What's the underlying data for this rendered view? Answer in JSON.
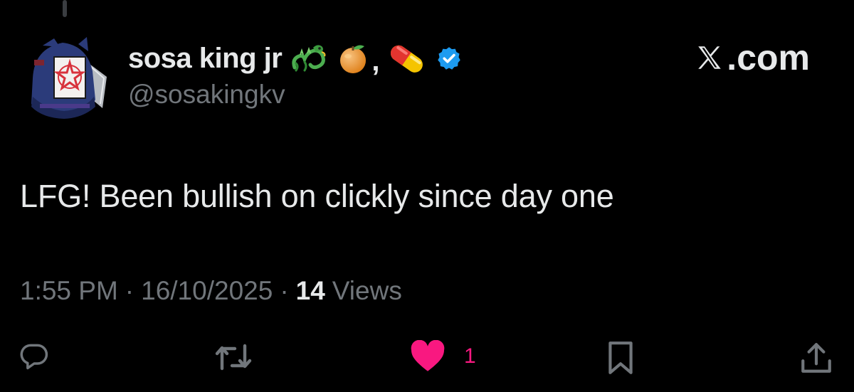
{
  "tweet": {
    "display_name": "sosa king jr",
    "name_emojis": [
      "dragon-emoji",
      "tangerine-emoji",
      "pill-emoji"
    ],
    "name_comma": ",",
    "verified": true,
    "handle": "@sosakingkv",
    "brand": ".com",
    "text": "LFG! Been bullish on clickly since day one",
    "time": "1:55 PM",
    "separator": "·",
    "date": "16/10/2025",
    "views_count": "14",
    "views_label": "Views"
  },
  "actions": {
    "like_count": "1",
    "icons": [
      "reply-icon",
      "retweet-icon",
      "like-icon",
      "bookmark-icon",
      "share-icon"
    ],
    "like_color": "#f91880",
    "icon_color": "#71767b"
  },
  "colors": {
    "background": "#000000",
    "text": "#e7e9ea",
    "muted": "#71767b",
    "verified": "#1d9bf0"
  }
}
